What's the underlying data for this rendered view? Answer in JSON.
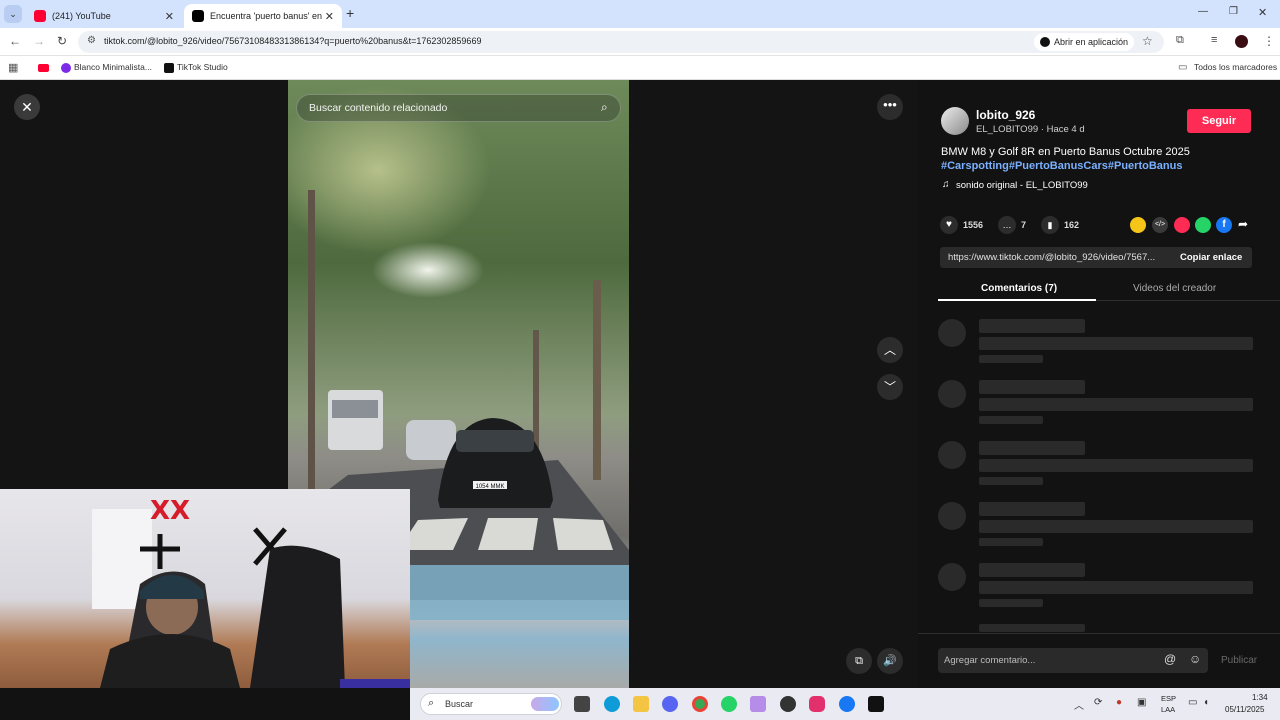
{
  "browser": {
    "tabs": [
      {
        "title": "(241) YouTube",
        "active": false
      },
      {
        "title": "Encuentra 'puerto banus' en Ti",
        "active": true
      }
    ],
    "new_tab": "+",
    "url": "tiktok.com/@lobito_926/video/7567310848331386134?q=puerto%20banus&t=1762302859669",
    "open_app": "Abrir en aplicación",
    "bookmarks": [
      "Blanco Minimalista...",
      "TikTok Studio"
    ],
    "all_bookmarks": "Todos los marcadores"
  },
  "video": {
    "search_placeholder": "Buscar contenido relacionado",
    "license_plate": "1054 MMK"
  },
  "post": {
    "username": "lobito_926",
    "subtitle": "EL_LOBITO99 · Hace 4 d",
    "follow": "Seguir",
    "caption": "BMW M8 y Golf 8R en Puerto Banus Octubre 2025",
    "hashtags": "#Carspotting#PuertoBanusCars#PuertoBanus",
    "sound": "sonido original - EL_LOBITO99",
    "likes": "1556",
    "comments": "7",
    "saves": "162",
    "link": "https://www.tiktok.com/@lobito_926/video/7567...",
    "copy_link": "Copiar enlace",
    "tab_comments": "Comentarios (7)",
    "tab_creator": "Videos del creador",
    "comment_placeholder": "Agregar comentario...",
    "publish": "Publicar"
  },
  "taskbar": {
    "search": "Buscar",
    "lang": "ESP",
    "lang2": "LAA",
    "time": "1:34",
    "date": "05/11/2025"
  },
  "colors": {
    "accent": "#fe2c55",
    "hashtag": "#7ab0ff",
    "tab_bg": "#d3e3fd"
  }
}
